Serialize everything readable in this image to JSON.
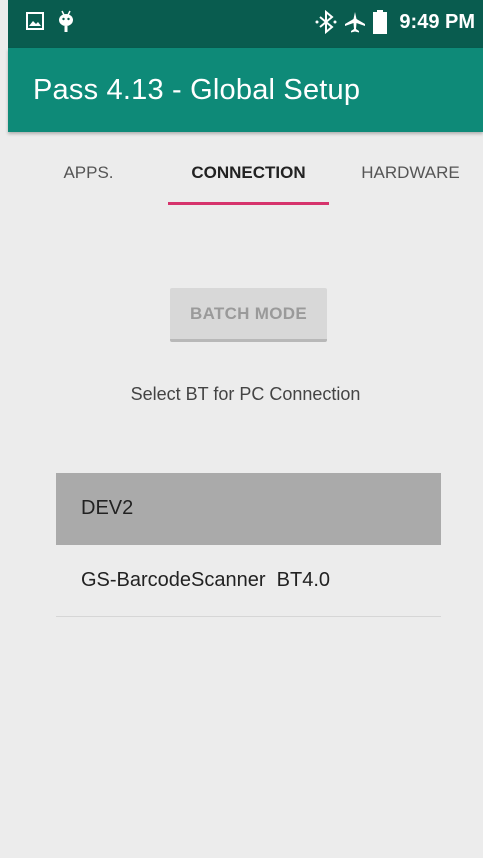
{
  "status_bar": {
    "time": "9:49 PM",
    "left_icons": [
      "image-notification-icon",
      "android-debug-icon"
    ],
    "right_icons": [
      "bluetooth-icon",
      "airplane-mode-icon",
      "battery-icon"
    ]
  },
  "app_bar": {
    "title": "Pass 4.13 - Global Setup"
  },
  "tabs": [
    {
      "label": "APPS.",
      "active": false
    },
    {
      "label": "CONNECTION",
      "active": true
    },
    {
      "label": "HARDWARE",
      "active": false
    }
  ],
  "main": {
    "batch_button_label": "BATCH MODE",
    "select_label": "Select BT for PC Connection",
    "devices": [
      {
        "name": "DEV2",
        "selected": true
      },
      {
        "name": "GS-BarcodeScanner  BT4.0",
        "selected": false
      }
    ]
  },
  "colors": {
    "status_bar": "#095c4f",
    "app_bar": "#0e8a78",
    "tab_indicator": "#d6336c",
    "selected_row": "#aaaaaa",
    "background": "#ececec"
  }
}
